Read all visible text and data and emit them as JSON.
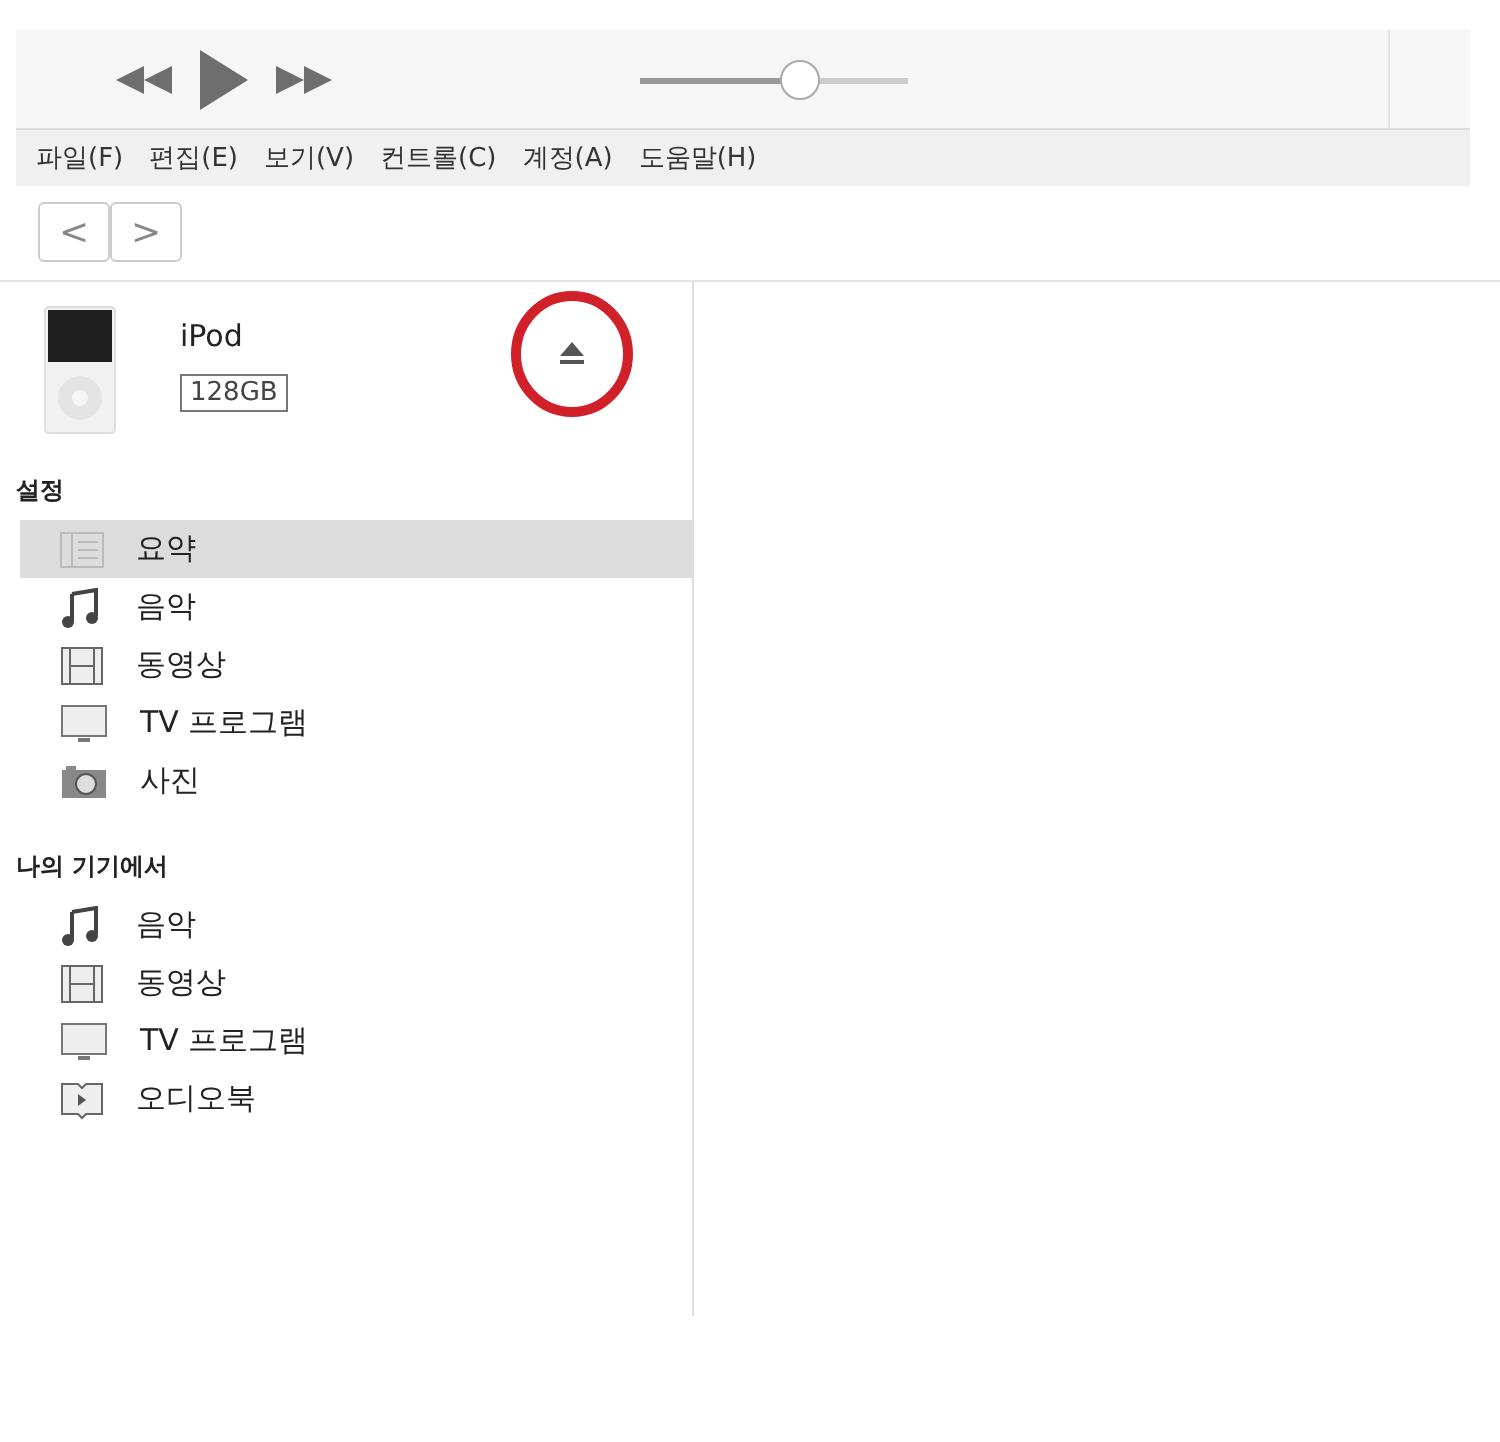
{
  "volume": {
    "level": 0.6
  },
  "menu": [
    "파일(F)",
    "편집(E)",
    "보기(V)",
    "컨트롤(C)",
    "계정(A)",
    "도움말(H)"
  ],
  "nav": {
    "back": "<",
    "forward": ">"
  },
  "device": {
    "name": "iPod",
    "capacity": "128GB",
    "eject_highlighted": true
  },
  "sections": [
    {
      "title": "설정",
      "items": [
        {
          "kind": "summary",
          "label": "요약",
          "selected": true
        },
        {
          "kind": "music",
          "label": "음악",
          "selected": false
        },
        {
          "kind": "movies",
          "label": "동영상",
          "selected": false
        },
        {
          "kind": "tv",
          "label": "TV 프로그램",
          "selected": false
        },
        {
          "kind": "photos",
          "label": "사진",
          "selected": false
        }
      ]
    },
    {
      "title": "나의 기기에서",
      "items": [
        {
          "kind": "music",
          "label": "음악",
          "selected": false
        },
        {
          "kind": "movies",
          "label": "동영상",
          "selected": false
        },
        {
          "kind": "tv",
          "label": "TV 프로그램",
          "selected": false
        },
        {
          "kind": "audiobooks",
          "label": "오디오북",
          "selected": false
        }
      ]
    }
  ]
}
